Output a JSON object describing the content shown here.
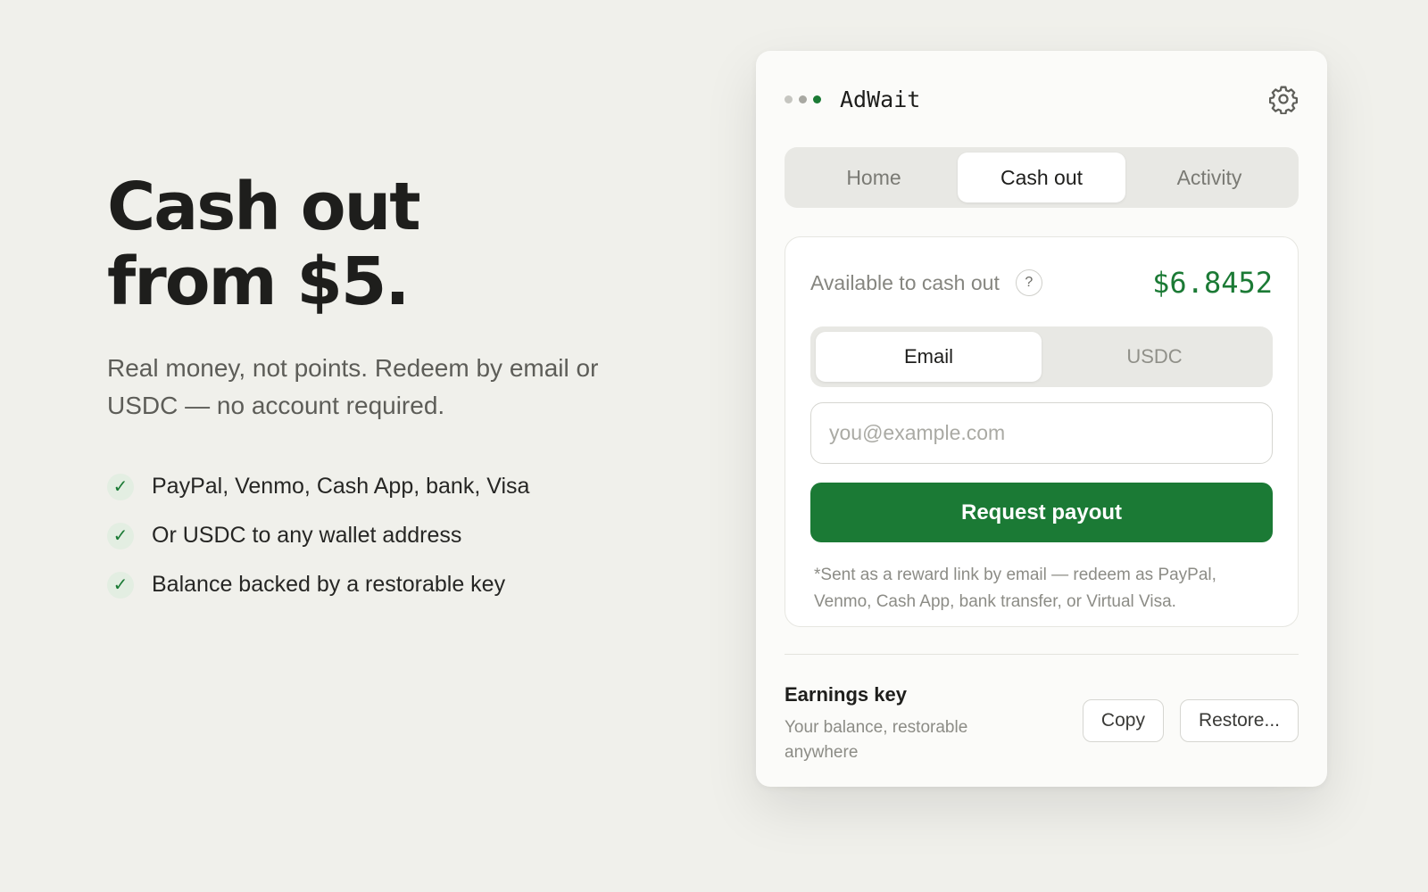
{
  "hero": {
    "title_line1": "Cash out",
    "title_line2": "from $5.",
    "subtitle": "Real money, not points. Redeem by email or USDC — no account required.",
    "check_glyph": "✓",
    "features": [
      "PayPal, Venmo, Cash App, bank, Visa",
      "Or USDC to any wallet address",
      "Balance backed by a restorable key"
    ]
  },
  "panel": {
    "app_name": "AdWait",
    "header_dots": [
      "#c6c6c1",
      "#a8a8a2",
      "#1b7a35"
    ],
    "settings_icon": "gear-icon",
    "tabs": [
      "Home",
      "Cash out",
      "Activity"
    ],
    "active_tab": "Cash out",
    "balance_label": "Available to cash out",
    "help_glyph": "?",
    "balance_amount": "$6.8452",
    "methods": [
      "Email",
      "USDC"
    ],
    "active_method": "Email",
    "email_value": "",
    "email_placeholder": "you@example.com",
    "payout_label": "Request payout",
    "note": "*Sent as a reward link by email — redeem as PayPal, Venmo, Cash App, bank transfer, or Virtual Visa.",
    "key_title": "Earnings key",
    "key_subtitle": "Your balance, restorable anywhere",
    "copy_label": "Copy",
    "restore_label": "Restore..."
  },
  "colors": {
    "page_background": "#f0f0eb",
    "accent": "#1b7a35",
    "panel_background": "#fbfbf9"
  }
}
